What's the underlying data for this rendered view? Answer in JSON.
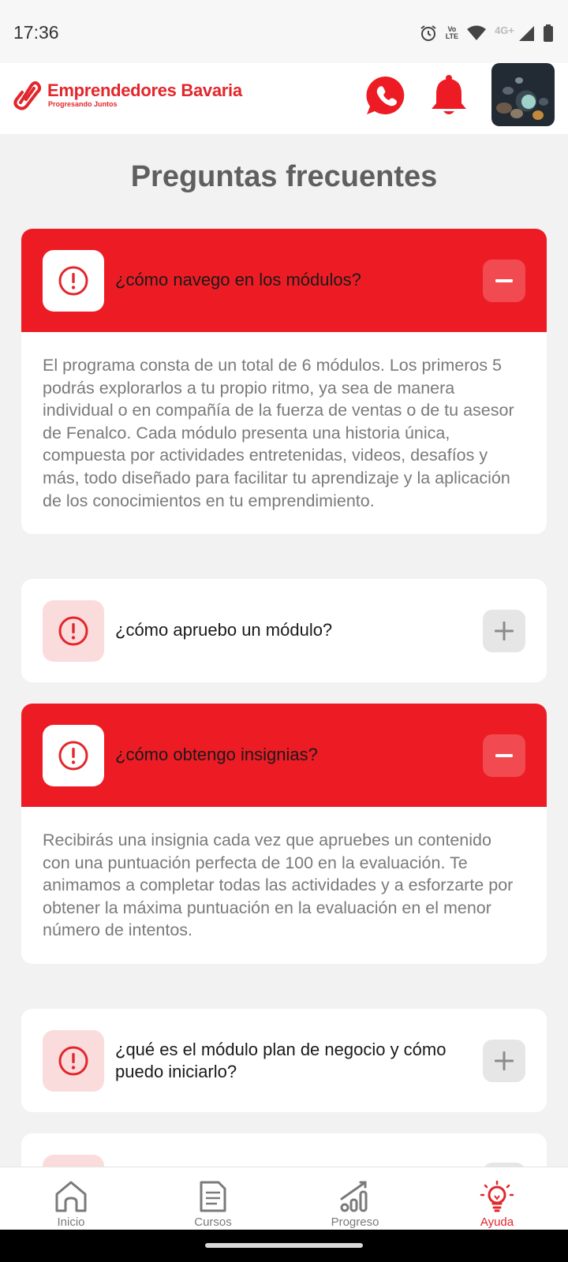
{
  "status_bar": {
    "time": "17:36",
    "network": "4G+",
    "volte": "Vo LTE"
  },
  "header": {
    "brand_title": "Emprendedores Bavaria",
    "brand_tagline": "Progresando Juntos",
    "whatsapp_icon": "whatsapp-icon",
    "bell_icon": "bell-icon",
    "brand_color": "#e3262b"
  },
  "page": {
    "title": "Preguntas frecuentes"
  },
  "faqs": [
    {
      "question": "¿cómo navego en los módulos?",
      "expanded": true,
      "answer": "El programa consta de un total de 6 módulos. Los primeros 5 podrás explorarlos a tu propio ritmo, ya sea de manera individual o en compañía de la fuerza de ventas o de tu asesor de Fenalco. Cada módulo presenta una historia única, compuesta por actividades entretenidas, videos, desafíos y más, todo diseñado para facilitar tu aprendizaje y la aplicación de los conocimientos en tu emprendimiento."
    },
    {
      "question": "¿cómo apruebo un módulo?",
      "expanded": false
    },
    {
      "question": "¿cómo obtengo insignias?",
      "expanded": true,
      "answer": "Recibirás una insignia cada vez que apruebes un contenido con una puntuación perfecta de 100 en la evaluación. Te animamos a completar todas las actividades y a esforzarte por obtener la máxima puntuación en la evaluación en el menor número de intentos."
    },
    {
      "question": "¿qué es el módulo plan de negocio y cómo puedo iniciarlo?",
      "expanded": false
    }
  ],
  "bottom_nav": [
    {
      "label": "Inicio",
      "icon": "home-icon",
      "active": false
    },
    {
      "label": "Cursos",
      "icon": "document-icon",
      "active": false
    },
    {
      "label": "Progreso",
      "icon": "chart-icon",
      "active": false
    },
    {
      "label": "Ayuda",
      "icon": "lightbulb-icon",
      "active": true
    }
  ]
}
